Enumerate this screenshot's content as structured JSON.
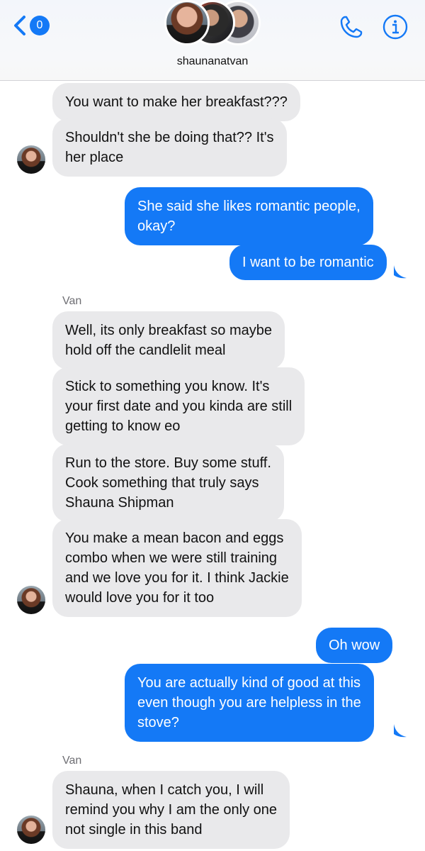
{
  "header": {
    "back_badge": "0",
    "conversation_name": "shaunanatvan",
    "icons": {
      "back": "chevron-left-icon",
      "call": "phone-icon",
      "info": "info-icon"
    },
    "accent_color": "#1479f6"
  },
  "messages": [
    {
      "id": "m1",
      "direction": "incoming",
      "text": "You want to make her breakfast???"
    },
    {
      "id": "m2",
      "direction": "incoming",
      "lines": [
        "Shouldn't she be doing that?? It's",
        "her place"
      ],
      "has_avatar": true
    },
    {
      "id": "m3",
      "direction": "outgoing",
      "lines": [
        "She said she likes romantic people,",
        "okay?"
      ]
    },
    {
      "id": "m4",
      "direction": "outgoing",
      "text": "I want to be romantic"
    },
    {
      "id": "s1",
      "type": "sender",
      "text": "Van"
    },
    {
      "id": "m5",
      "direction": "incoming",
      "lines": [
        "Well, its only breakfast so maybe",
        "hold off the candlelit meal"
      ]
    },
    {
      "id": "m6",
      "direction": "incoming",
      "lines": [
        "Stick to something you know. It's",
        "your first date and you kinda are still",
        "getting to know eo"
      ]
    },
    {
      "id": "m7",
      "direction": "incoming",
      "lines": [
        "Run to the store. Buy some stuff.",
        "Cook something that truly says",
        "Shauna Shipman"
      ]
    },
    {
      "id": "m8",
      "direction": "incoming",
      "lines": [
        "You make a mean bacon and eggs",
        "combo when we were still training",
        "and we love you for it. I think Jackie",
        "would love you for it too"
      ],
      "has_avatar": true
    },
    {
      "id": "m9",
      "direction": "outgoing",
      "text": "Oh wow"
    },
    {
      "id": "m10",
      "direction": "outgoing",
      "lines": [
        "You are actually kind of good at this",
        "even though you are helpless in the",
        "stove?"
      ]
    },
    {
      "id": "s2",
      "type": "sender",
      "text": "Van"
    },
    {
      "id": "m11",
      "direction": "incoming",
      "lines": [
        "Shauna, when I catch you, I will",
        "remind you why I am the only one",
        "not single in this band"
      ],
      "has_avatar": true
    }
  ]
}
